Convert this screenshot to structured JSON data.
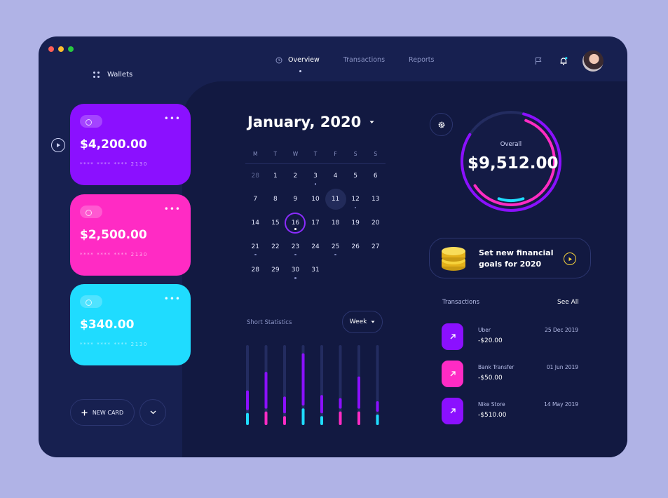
{
  "colors": {
    "background": "#b0b3e6",
    "window": "#172050",
    "panel": "#121941",
    "purple": "#8b10ff",
    "pink": "#ff2bc4",
    "cyan": "#1fdcff",
    "yellow": "#f6d33c"
  },
  "sidebar": {
    "title": "Wallets",
    "cards": [
      {
        "amount": "$4,200.00",
        "number": "**** **** **** 2130",
        "color": "#8b10ff"
      },
      {
        "amount": "$2,500.00",
        "number": "**** **** **** 2130",
        "color": "#ff2bc4"
      },
      {
        "amount": "$340.00",
        "number": "**** **** **** 2130",
        "color": "#1fdcff"
      }
    ],
    "new_card_label": "NEW CARD"
  },
  "nav": {
    "tabs": [
      {
        "label": "Overview",
        "active": true
      },
      {
        "label": "Transactions",
        "active": false
      },
      {
        "label": "Reports",
        "active": false
      }
    ]
  },
  "calendar": {
    "title": "January, 2020",
    "weekdays": [
      "M",
      "T",
      "W",
      "T",
      "F",
      "S",
      "S"
    ],
    "weeks": [
      [
        "28",
        "1",
        "2",
        "3",
        "4",
        "5",
        "6"
      ],
      [
        "7",
        "8",
        "9",
        "10",
        "11",
        "12",
        "13"
      ],
      [
        "14",
        "15",
        "16",
        "17",
        "18",
        "19",
        "20"
      ],
      [
        "21",
        "22",
        "23",
        "24",
        "25",
        "26",
        "27"
      ],
      [
        "28",
        "29",
        "30",
        "31",
        "",
        "",
        ""
      ]
    ],
    "muted": [
      [
        0,
        0
      ]
    ],
    "selected": [
      2,
      2
    ],
    "hover": [
      1,
      4
    ],
    "dots": [
      [
        0,
        3
      ],
      [
        1,
        5
      ],
      [
        2,
        2
      ],
      [
        3,
        0
      ],
      [
        3,
        2
      ],
      [
        3,
        4
      ],
      [
        4,
        2
      ]
    ]
  },
  "stats": {
    "label": "Short Statistics",
    "period": "Week",
    "bars": [
      {
        "purple": 0.22,
        "pink": 0.0,
        "cyan": 0.12
      },
      {
        "purple": 0.44,
        "pink": 0.14,
        "cyan": 0.0
      },
      {
        "purple": 0.18,
        "pink": 0.08,
        "cyan": 0.0
      },
      {
        "purple": 0.64,
        "pink": 0.0,
        "cyan": 0.18
      },
      {
        "purple": 0.2,
        "pink": 0.0,
        "cyan": 0.08
      },
      {
        "purple": 0.1,
        "pink": 0.14,
        "cyan": 0.0
      },
      {
        "purple": 0.38,
        "pink": 0.14,
        "cyan": 0.0
      },
      {
        "purple": 0.1,
        "pink": 0.0,
        "cyan": 0.1
      }
    ]
  },
  "overview": {
    "label": "Overall",
    "amount": "$9,512.00",
    "purple_progress": 0.8,
    "pink_progress": 0.6
  },
  "goals": {
    "text": "Set new financial goals for 2020"
  },
  "transactions": {
    "title": "Transactions",
    "see_all": "See All",
    "items": [
      {
        "name": "Uber",
        "amount": "-$20.00",
        "date": "25 Dec 2019",
        "color": "#8b10ff"
      },
      {
        "name": "Bank Transfer",
        "amount": "-$50.00",
        "date": "01 Jun 2019",
        "color": "#ff2bc4"
      },
      {
        "name": "Nike Store",
        "amount": "-$510.00",
        "date": "14 May 2019",
        "color": "#8b10ff"
      }
    ]
  }
}
